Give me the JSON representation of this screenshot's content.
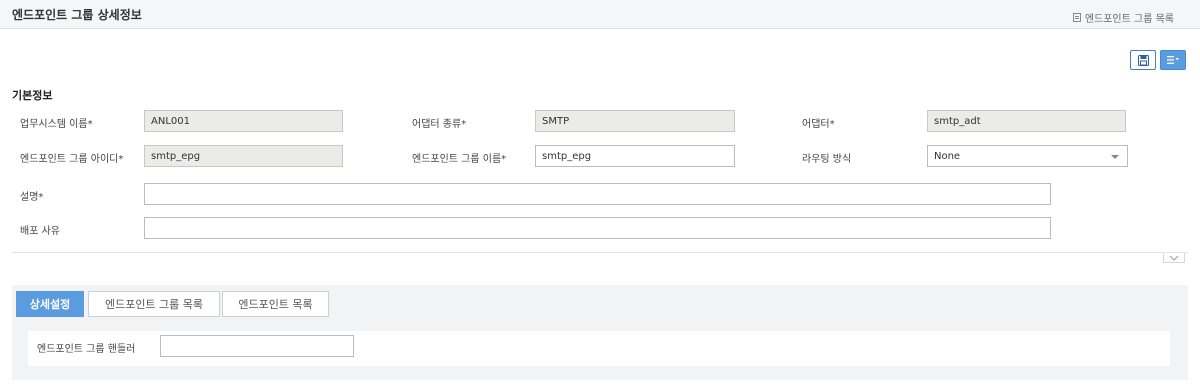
{
  "header": {
    "title": "엔드포인트 그룹 상세정보",
    "list_link": "엔드포인트 그룹 목록"
  },
  "section": {
    "title": "기본정보"
  },
  "form": {
    "business_system_name": {
      "label": "업무시스템 이름",
      "value": "ANL001"
    },
    "adapter_type": {
      "label": "어댑터 종류",
      "value": "SMTP"
    },
    "adapter": {
      "label": "어댑터",
      "value": "smtp_adt"
    },
    "endpoint_group_id": {
      "label": "엔드포인트 그룹 아이디",
      "value": "smtp_epg"
    },
    "endpoint_group_name": {
      "label": "엔드포인트 그룹 이름",
      "value": "smtp_epg"
    },
    "routing_method": {
      "label": "라우팅 방식",
      "value": "None"
    },
    "description": {
      "label": "설명",
      "value": ""
    },
    "deploy_reason": {
      "label": "배포 사유",
      "value": ""
    },
    "required_mark": "*"
  },
  "tabs": [
    {
      "label": "상세설정",
      "active": true
    },
    {
      "label": "엔드포인트 그룹 목록",
      "active": false
    },
    {
      "label": "엔드포인트 목록",
      "active": false
    }
  ],
  "detail": {
    "handler_label": "엔드포인트 그룹 핸들러",
    "handler_value": ""
  },
  "colors": {
    "accent": "#5b9be0",
    "readonly_bg": "#ebebe7"
  },
  "icons": {
    "list": "list-icon",
    "save": "save-icon",
    "menu": "menu-dropdown-icon",
    "collapse": "chevron-down-icon"
  }
}
